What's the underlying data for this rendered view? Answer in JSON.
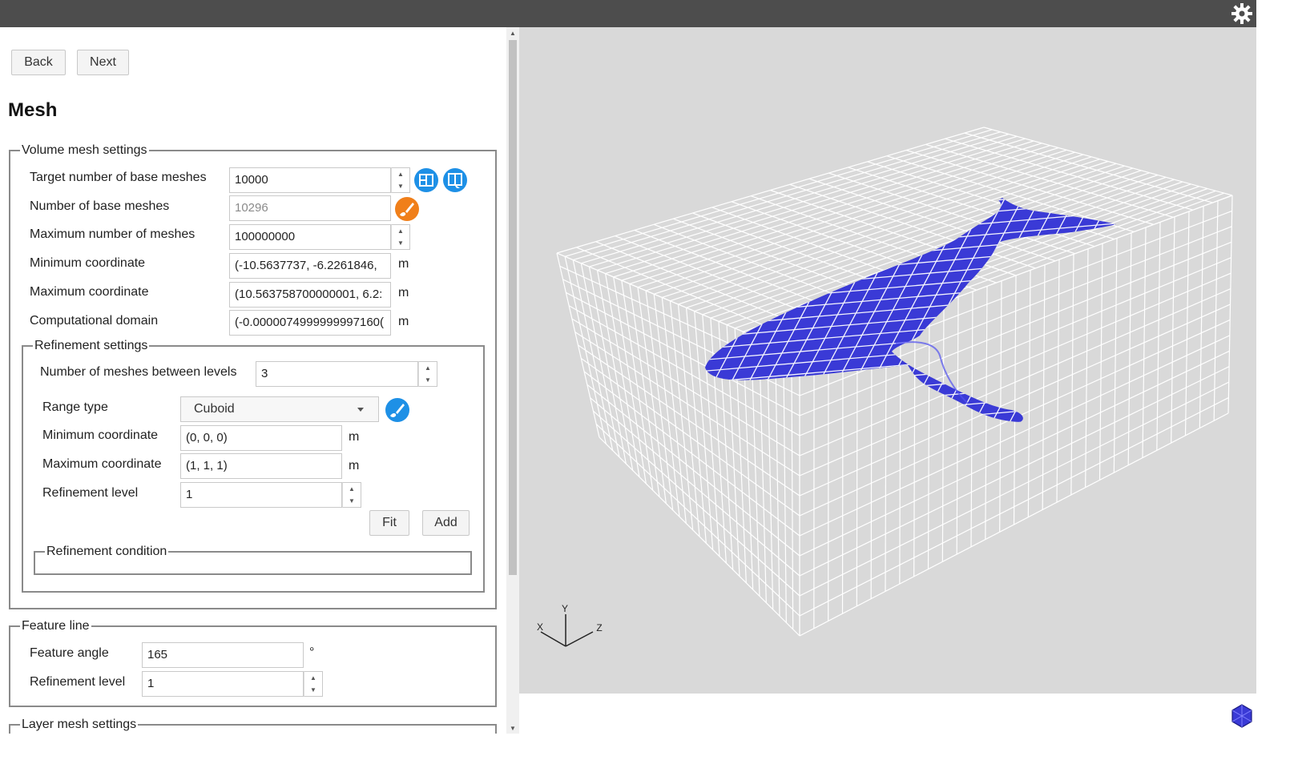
{
  "nav": {
    "back_label": "Back",
    "next_label": "Next"
  },
  "page": {
    "title": "Mesh"
  },
  "volume": {
    "legend": "Volume mesh settings",
    "target_label": "Target number of base meshes",
    "target_value": "10000",
    "number_label": "Number of base meshes",
    "number_value": "10296",
    "max_label": "Maximum number of meshes",
    "max_value": "100000000",
    "min_coord_label": "Minimum coordinate",
    "min_coord_value": "(-10.5637737, -6.2261846,",
    "max_coord_label": "Maximum coordinate",
    "max_coord_value": "(10.563758700000001, 6.2:",
    "domain_label": "Computational domain",
    "domain_value": "(-0.0000074999999997160(",
    "unit": "m"
  },
  "refinement": {
    "legend": "Refinement settings",
    "between_label": "Number of meshes between levels",
    "between_value": "3",
    "range_label": "Range type",
    "range_value": "Cuboid",
    "min_label": "Minimum coordinate",
    "min_value": "(0, 0, 0)",
    "max_label": "Maximum coordinate",
    "max_value": "(1, 1, 1)",
    "level_label": "Refinement level",
    "level_value": "1",
    "unit": "m",
    "fit_label": "Fit",
    "add_label": "Add",
    "condition_legend": "Refinement condition"
  },
  "feature": {
    "legend": "Feature line",
    "angle_label": "Feature angle",
    "angle_value": "165",
    "angle_unit": "°",
    "level_label": "Refinement level",
    "level_value": "1"
  },
  "layer": {
    "legend": "Layer mesh settings"
  },
  "axes": {
    "x": "X",
    "y": "Y",
    "z": "Z"
  },
  "colors": {
    "topbar": "#4d4d4d",
    "viewport_bg": "#d9d9d9",
    "model": "#3a3ad6",
    "accent_blue": "#1e90e6",
    "accent_orange": "#f07f1a"
  },
  "icons": [
    "gear-icon",
    "mesh-count-icon",
    "mesh-split-icon",
    "orange-brush-icon",
    "blue-brush-icon",
    "polyhedron-icon"
  ]
}
